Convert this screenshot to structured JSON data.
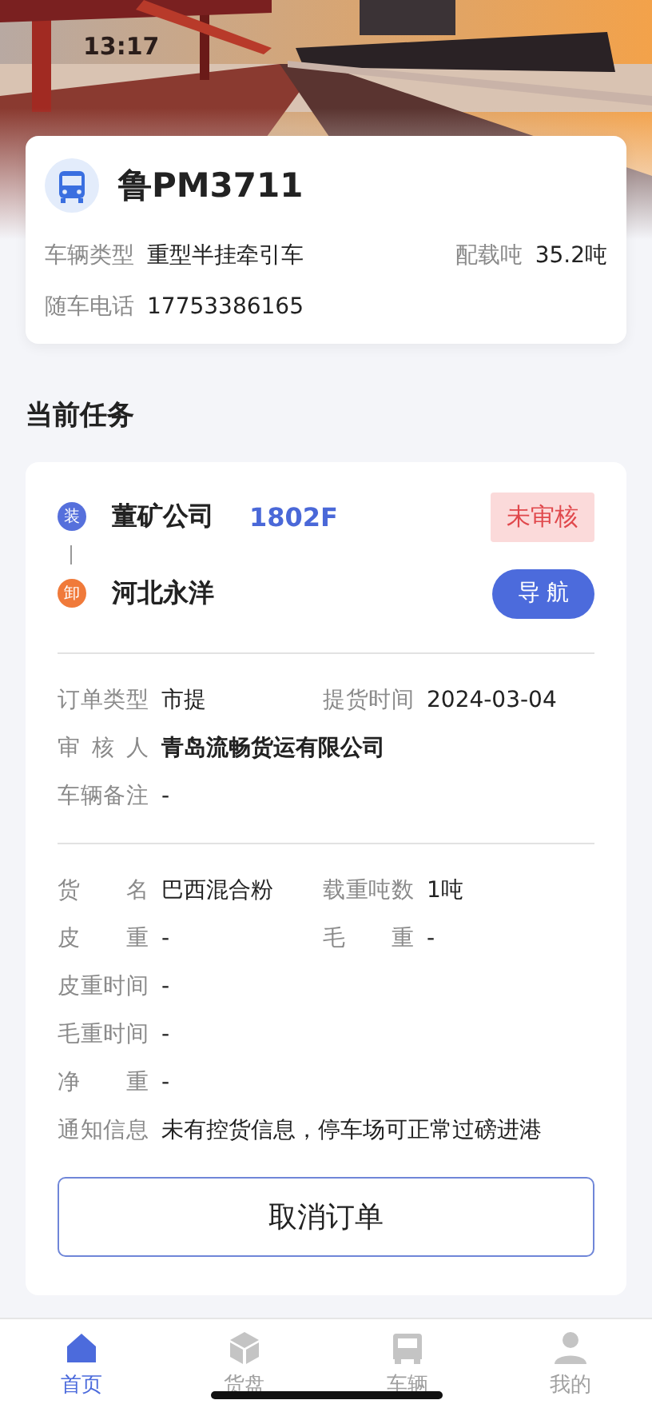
{
  "status_bar": {
    "time": "13:17"
  },
  "vehicle": {
    "plate": "鲁PM3711",
    "fields": [
      {
        "label": "车辆类型",
        "value": "重型半挂牵引车"
      },
      {
        "label": "配载吨",
        "value": "35.2吨"
      },
      {
        "label": "随车电话",
        "value": "17753386165"
      }
    ]
  },
  "section_title": "当前任务",
  "task": {
    "stops": [
      {
        "kind": "load",
        "badge": "装",
        "name": "董矿公司",
        "code": "1802F"
      },
      {
        "kind": "unload",
        "badge": "卸",
        "name": "河北永洋"
      }
    ],
    "status": "未审核",
    "nav_button": "导 航",
    "info_rows": [
      [
        {
          "label": "订单类型",
          "value": "市提"
        },
        {
          "label": "提货时间",
          "value": "2024-03-04"
        }
      ],
      [
        {
          "label": "审核人",
          "value": "青岛流畅货运有限公司",
          "kind": "strong"
        }
      ],
      [
        {
          "label": "车辆备注",
          "value": "-"
        }
      ]
    ],
    "cargo_rows": [
      [
        {
          "label": "货名",
          "value": "巴西混合粉"
        },
        {
          "label": "载重吨数",
          "value": "1吨"
        }
      ],
      [
        {
          "label": "皮重",
          "value": "-"
        },
        {
          "label": "毛重",
          "value": "-"
        }
      ],
      [
        {
          "label": "皮重时间",
          "value": "-"
        }
      ],
      [
        {
          "label": "毛重时间",
          "value": "-"
        }
      ],
      [
        {
          "label": "净重",
          "value": "-"
        }
      ],
      [
        {
          "label": "通知信息",
          "value": "未有控货信息，停车场可正常过磅进港"
        }
      ]
    ],
    "cancel_button": "取消订单"
  },
  "tab_bar": [
    {
      "kind": "home",
      "label": "首页",
      "selected": true
    },
    {
      "kind": "cargo",
      "label": "货盘",
      "selected": false
    },
    {
      "kind": "vehicle",
      "label": "车辆",
      "selected": false
    },
    {
      "kind": "profile",
      "label": "我的",
      "selected": false
    }
  ]
}
